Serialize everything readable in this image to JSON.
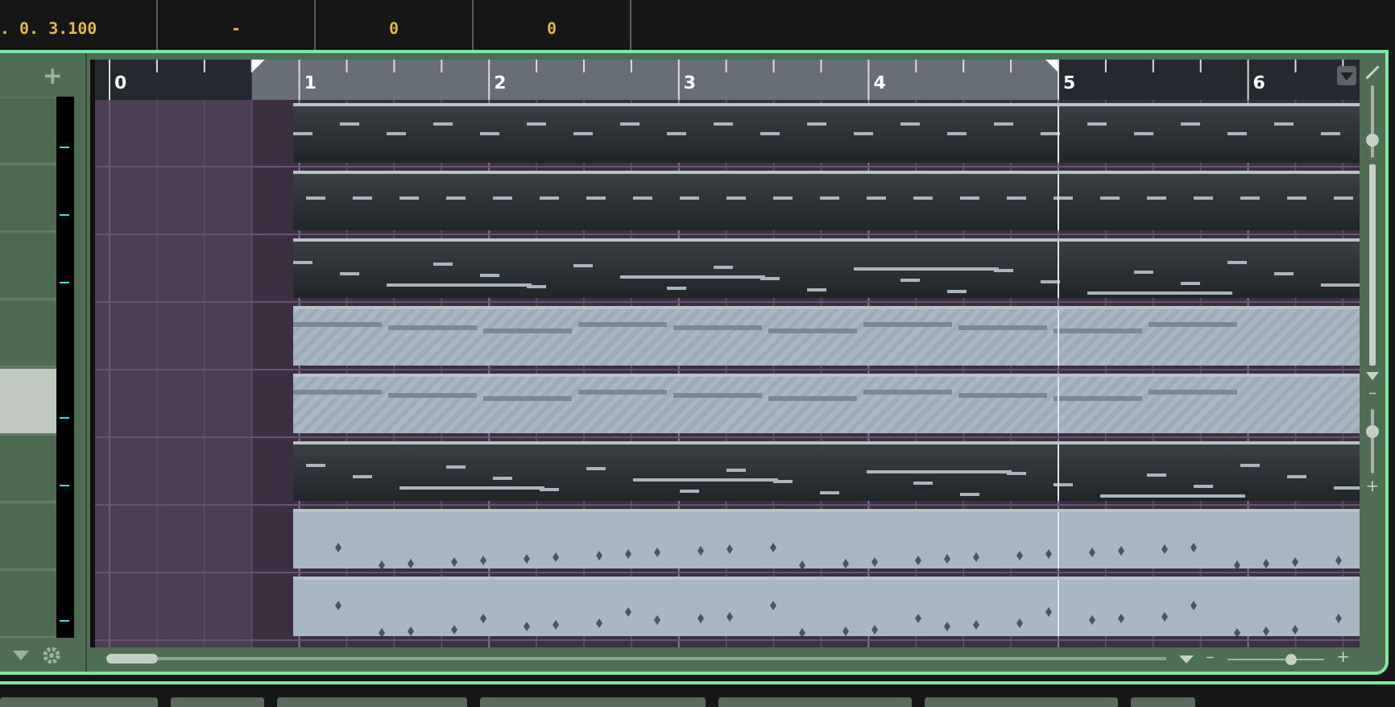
{
  "transport": {
    "cells": [
      ". 0. 3.100",
      "-",
      "0",
      "0"
    ]
  },
  "ruler": {
    "bars": [
      "0",
      "1",
      "2",
      "3",
      "4",
      "5",
      "6"
    ]
  },
  "add_track_button": "+",
  "tracks": [
    {
      "kind": "midi",
      "selected": false,
      "meter_active": true
    },
    {
      "kind": "midi",
      "selected": false,
      "meter_active": true
    },
    {
      "kind": "midi",
      "selected": false,
      "meter_active": true
    },
    {
      "kind": "audio",
      "selected": false,
      "meter_active": false
    },
    {
      "kind": "audio",
      "selected": true,
      "meter_active": true
    },
    {
      "kind": "midi",
      "selected": false,
      "meter_active": true
    },
    {
      "kind": "drum",
      "selected": false,
      "meter_active": false
    },
    {
      "kind": "drum",
      "selected": false,
      "meter_active": true
    }
  ],
  "zoom": {
    "minus": "–",
    "plus": "+",
    "level": 0.65,
    "vertical": {
      "level": 0.2
    },
    "vertical_minus": "–",
    "vertical_plus": "+",
    "track_height": {
      "level": 0.7
    }
  }
}
